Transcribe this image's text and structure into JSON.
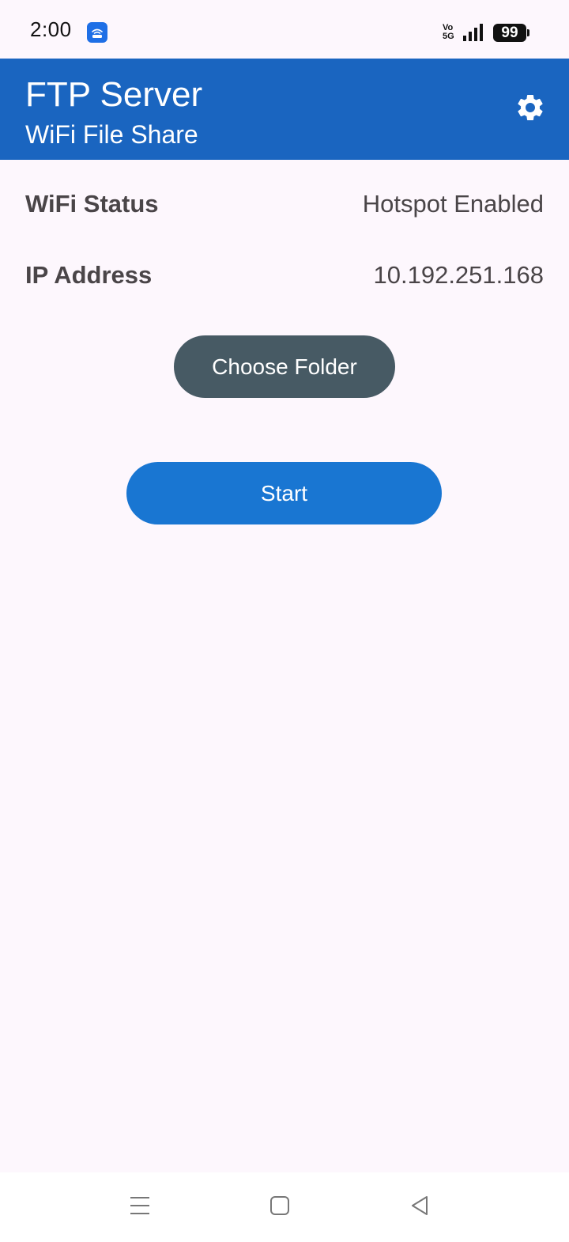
{
  "status_bar": {
    "time": "2:00",
    "app_icon": "wifi-router-icon",
    "network_type": "Vo\n5G",
    "battery_level": "99"
  },
  "app_bar": {
    "title": "FTP Server",
    "subtitle": "WiFi File Share",
    "settings_icon": "gear-icon",
    "background_color": "#1A65C0"
  },
  "info": {
    "wifi_status_label": "WiFi Status",
    "wifi_status_value": "Hotspot Enabled",
    "ip_label": "IP Address",
    "ip_value": "10.192.251.168"
  },
  "actions": {
    "choose_folder_label": "Choose Folder",
    "choose_folder_color": "#475A64",
    "start_label": "Start",
    "start_color": "#1976D2"
  },
  "nav_bar": {
    "menu_icon": "menu-icon",
    "home_icon": "home-square-icon",
    "back_icon": "back-triangle-icon"
  }
}
